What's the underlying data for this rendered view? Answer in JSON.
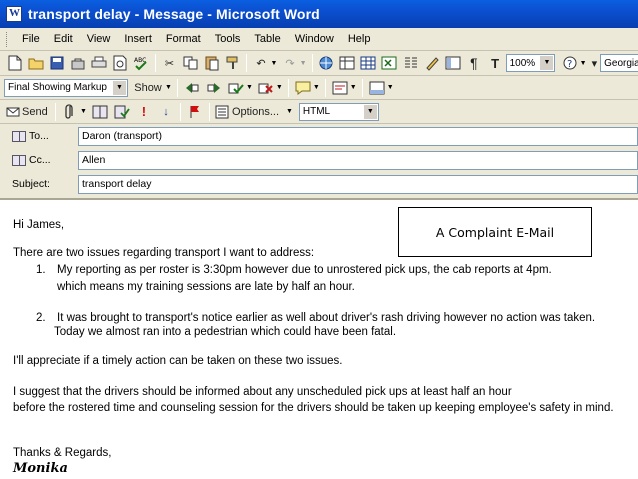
{
  "window": {
    "title": "transport delay - Message - Microsoft Word"
  },
  "menu": [
    "File",
    "Edit",
    "View",
    "Insert",
    "Format",
    "Tools",
    "Table",
    "Window",
    "Help"
  ],
  "toolbar": {
    "zoom": "100%",
    "font": "Georgia"
  },
  "review_toolbar": {
    "markup_mode": "Final Showing Markup",
    "show_label": "Show"
  },
  "email_toolbar": {
    "send_label": "Send",
    "options_label": "Options...",
    "format": "HTML"
  },
  "header": {
    "to_label": "To...",
    "to_value": "Daron (transport)",
    "cc_label": "Cc...",
    "cc_value": "Allen",
    "subject_label": "Subject:",
    "subject_value": "transport delay"
  },
  "callout": "A Complaint E-Mail",
  "message": {
    "greeting": "Hi James,",
    "intro": "There are two issues regarding transport I want to address:",
    "item1_num": "1.",
    "item1_line1": "My reporting as per roster is 3:30pm however due to unrostered pick ups, the cab reports at 4pm.",
    "item1_line2": "which means my training sessions are late by half an hour.",
    "item2_num": "2.",
    "item2_line1": "It was brought to transport's notice earlier as well about driver's rash driving however no action was taken.",
    "item2_line2": "Today we almost ran into a pedestrian which could have been fatal.",
    "request": "I'll appreciate if a timely action can be taken on these two issues.",
    "suggest_line1": "I suggest that the drivers should be informed about any unscheduled pick ups at least half an hour",
    "suggest_line2": "before the rostered time and counseling session for the drivers should be taken up keeping employee's safety in mind.",
    "closing": "Thanks & Regards,",
    "signature": "Monika"
  }
}
